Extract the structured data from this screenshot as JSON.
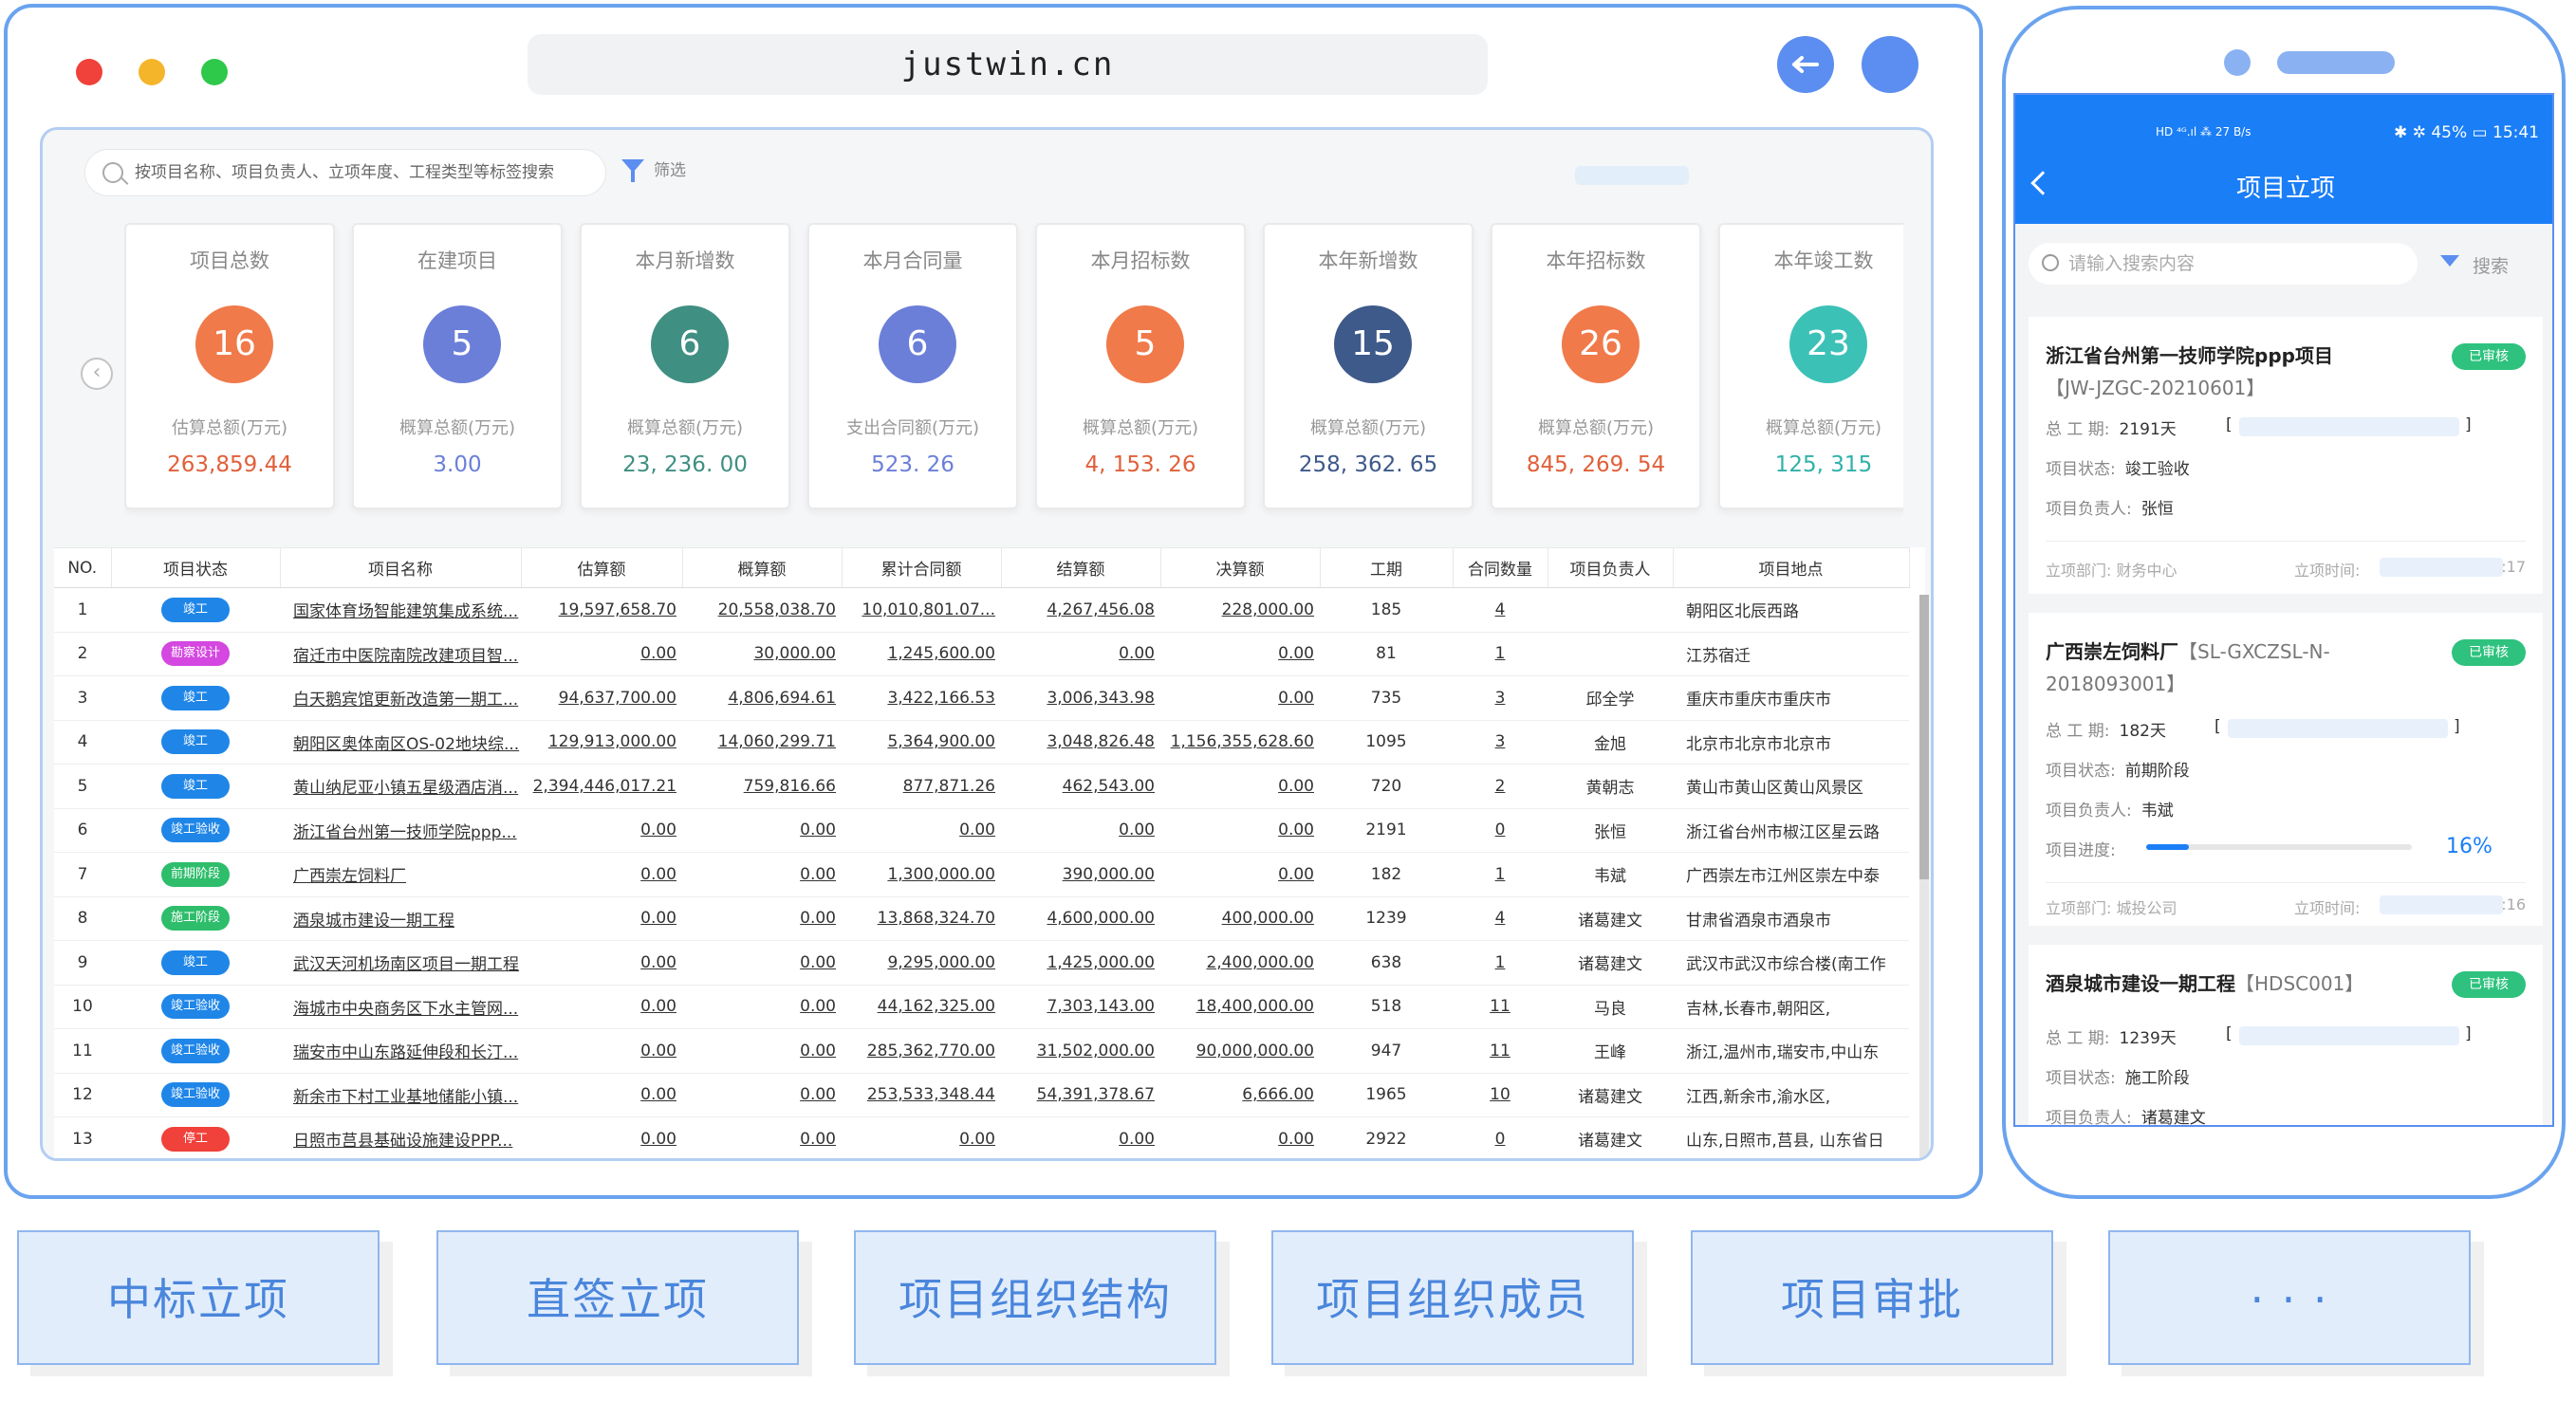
{
  "browser": {
    "url": "justwin.cn",
    "traffic_colors": [
      "#f0413a",
      "#f5b52b",
      "#2ec94a"
    ]
  },
  "toolbar": {
    "search_placeholder": "按项目名称、项目负责人、立项年度、工程类型等标签搜索",
    "filter_label": "筛选"
  },
  "cards": [
    {
      "label": "项目总数",
      "count": "16",
      "color": "#f07a4a",
      "sub": "估算总额(万元)",
      "value": "263,859.44",
      "value_color": "#e0603a"
    },
    {
      "label": "在建项目",
      "count": "5",
      "color": "#6b7fd9",
      "sub": "概算总额(万元)",
      "value": "3.00",
      "value_color": "#6b7fd9"
    },
    {
      "label": "本月新增数",
      "count": "6",
      "color": "#3f8f82",
      "sub": "概算总额(万元)",
      "value": "23, 236. 00",
      "value_color": "#3f8f82"
    },
    {
      "label": "本月合同量",
      "count": "6",
      "color": "#6b7fd9",
      "sub": "支出合同额(万元)",
      "value": "523. 26",
      "value_color": "#6b7fd9"
    },
    {
      "label": "本月招标数",
      "count": "5",
      "color": "#f07a4a",
      "sub": "概算总额(万元)",
      "value": "4, 153. 26",
      "value_color": "#e0603a"
    },
    {
      "label": "本年新增数",
      "count": "15",
      "color": "#3e5a8a",
      "sub": "概算总额(万元)",
      "value": "258, 362. 65",
      "value_color": "#3e5a8a"
    },
    {
      "label": "本年招标数",
      "count": "26",
      "color": "#f07a4a",
      "sub": "概算总额(万元)",
      "value": "845, 269. 54",
      "value_color": "#e0603a"
    },
    {
      "label": "本年竣工数",
      "count": "23",
      "color": "#3cc1b7",
      "sub": "概算总额(万元)",
      "value": "125, 315",
      "value_color": "#2fb1a8"
    }
  ],
  "table": {
    "headers": [
      "NO.",
      "项目状态",
      "项目名称",
      "估算额",
      "概算额",
      "累计合同额",
      "结算额",
      "决算额",
      "工期",
      "合同数量",
      "项目负责人",
      "项目地点"
    ],
    "rows": [
      {
        "no": "1",
        "status": "竣工",
        "status_color": "#1f86e8",
        "name": "国家体育场智能建筑集成系统...",
        "est": "19,597,658.70",
        "budget": "20,558,038.70",
        "contract": "10,010,801.07...",
        "settle": "4,267,456.08",
        "final": "228,000.00",
        "period": "185",
        "count": "4",
        "owner": "",
        "addr": "朝阳区北辰西路"
      },
      {
        "no": "2",
        "status": "勘察设计",
        "status_color": "#d447e0",
        "name": "宿迁市中医院南院改建项目智...",
        "est": "0.00",
        "budget": "30,000.00",
        "contract": "1,245,600.00",
        "settle": "0.00",
        "final": "0.00",
        "period": "81",
        "count": "1",
        "owner": "",
        "addr": "江苏宿迁"
      },
      {
        "no": "3",
        "status": "竣工",
        "status_color": "#1f86e8",
        "name": "白天鹅宾馆更新改造第一期工...",
        "est": "94,637,700.00",
        "budget": "4,806,694.61",
        "contract": "3,422,166.53",
        "settle": "3,006,343.98",
        "final": "0.00",
        "period": "735",
        "count": "3",
        "owner": "邱全学",
        "addr": "重庆市重庆市重庆市"
      },
      {
        "no": "4",
        "status": "竣工",
        "status_color": "#1f86e8",
        "name": "朝阳区奥体南区OS-02地块综...",
        "est": "129,913,000.00",
        "budget": "14,060,299.71",
        "contract": "5,364,900.00",
        "settle": "3,048,826.48",
        "final": "1,156,355,628.60",
        "period": "1095",
        "count": "3",
        "owner": "金旭",
        "addr": "北京市北京市北京市"
      },
      {
        "no": "5",
        "status": "竣工",
        "status_color": "#1f86e8",
        "name": "黄山纳尼亚小镇五星级酒店消...",
        "est": "2,394,446,017.21",
        "budget": "759,816.66",
        "contract": "877,871.26",
        "settle": "462,543.00",
        "final": "0.00",
        "period": "720",
        "count": "2",
        "owner": "黄朝志",
        "addr": "黄山市黄山区黄山风景区"
      },
      {
        "no": "6",
        "status": "竣工验收",
        "status_color": "#1f86e8",
        "name": "浙江省台州第一技师学院ppp...",
        "est": "0.00",
        "budget": "0.00",
        "contract": "0.00",
        "settle": "0.00",
        "final": "0.00",
        "period": "2191",
        "count": "0",
        "owner": "张恒",
        "addr": "浙江省台州市椒江区星云路"
      },
      {
        "no": "7",
        "status": "前期阶段",
        "status_color": "#2ebd6b",
        "name": "广西崇左饲料厂",
        "est": "0.00",
        "budget": "0.00",
        "contract": "1,300,000.00",
        "settle": "390,000.00",
        "final": "0.00",
        "period": "182",
        "count": "1",
        "owner": "韦斌",
        "addr": "广西崇左市江州区崇左中泰"
      },
      {
        "no": "8",
        "status": "施工阶段",
        "status_color": "#2ebd6b",
        "name": "酒泉城市建设一期工程",
        "est": "0.00",
        "budget": "0.00",
        "contract": "13,868,324.70",
        "settle": "4,600,000.00",
        "final": "400,000.00",
        "period": "1239",
        "count": "4",
        "owner": "诸葛建文",
        "addr": "甘肃省酒泉市酒泉市"
      },
      {
        "no": "9",
        "status": "竣工",
        "status_color": "#1f86e8",
        "name": "武汉天河机场南区项目一期工程",
        "est": "0.00",
        "budget": "0.00",
        "contract": "9,295,000.00",
        "settle": "1,425,000.00",
        "final": "2,400,000.00",
        "period": "638",
        "count": "1",
        "owner": "诸葛建文",
        "addr": "武汉市武汉市综合楼(南工作"
      },
      {
        "no": "10",
        "status": "竣工验收",
        "status_color": "#1f86e8",
        "name": "海城市中央商务区下水主管网...",
        "est": "0.00",
        "budget": "0.00",
        "contract": "44,162,325.00",
        "settle": "7,303,143.00",
        "final": "18,400,000.00",
        "period": "518",
        "count": "11",
        "owner": "马良",
        "addr": "吉林,长春市,朝阳区,"
      },
      {
        "no": "11",
        "status": "竣工验收",
        "status_color": "#1f86e8",
        "name": "瑞安市中山东路延伸段和长汀...",
        "est": "0.00",
        "budget": "0.00",
        "contract": "285,362,770.00",
        "settle": "31,502,000.00",
        "final": "90,000,000.00",
        "period": "947",
        "count": "11",
        "owner": "王峰",
        "addr": "浙江,温州市,瑞安市,中山东"
      },
      {
        "no": "12",
        "status": "竣工验收",
        "status_color": "#1f86e8",
        "name": "新余市下村工业基地储能小镇...",
        "est": "0.00",
        "budget": "0.00",
        "contract": "253,533,348.44",
        "settle": "54,391,378.67",
        "final": "6,666.00",
        "period": "1965",
        "count": "10",
        "owner": "诸葛建文",
        "addr": "江西,新余市,渝水区,"
      },
      {
        "no": "13",
        "status": "停工",
        "status_color": "#f0413a",
        "name": "日照市莒县基础设施建设PPP...",
        "est": "0.00",
        "budget": "0.00",
        "contract": "0.00",
        "settle": "0.00",
        "final": "0.00",
        "period": "2922",
        "count": "0",
        "owner": "诸葛建文",
        "addr": "山东,日照市,莒县, 山东省日"
      }
    ]
  },
  "phone": {
    "status_left": "HD ⁴ᴳ.ıl  ⁂  27 B/s",
    "status_right": "✱ ✲ 45% ▭ 15:41",
    "title": "项目立项",
    "search_placeholder": "请输入搜索内容",
    "filter_label": "搜索",
    "cards": [
      {
        "title": "浙江省台州第一技师学院ppp项目",
        "code": "【JW-JZGC-20210601】",
        "status": "已审核",
        "period_label": "总 工 期:",
        "period": "2191天",
        "state_label": "项目状态:",
        "state": "竣工验收",
        "owner_label": "项目负责人:",
        "owner": "张恒",
        "dept_label": "立项部门:",
        "dept": "财务中心",
        "time_label": "立项时间:",
        "time_tail": ":17"
      },
      {
        "title": "广西崇左饲料厂",
        "code": "【SL-GXCZSL-N-2018093001】",
        "status": "已审核",
        "period_label": "总 工 期:",
        "period": "182天",
        "state_label": "项目状态:",
        "state": "前期阶段",
        "owner_label": "项目负责人:",
        "owner": "韦斌",
        "progress_label": "项目进度:",
        "progress_text": "16%",
        "progress": 0.16,
        "dept_label": "立项部门:",
        "dept": "城投公司",
        "time_label": "立项时间:",
        "time_tail": ":16"
      },
      {
        "title": "酒泉城市建设一期工程",
        "code": "【HDSC001】",
        "status": "已审核",
        "period_label": "总 工 期:",
        "period": "1239天",
        "state_label": "项目状态:",
        "state": "施工阶段",
        "owner_label": "项目负责人:",
        "owner": "诸葛建文"
      }
    ]
  },
  "bottom_buttons": [
    "中标立项",
    "直签立项",
    "项目组织结构",
    "项目组织成员",
    "项目审批",
    "· · ·"
  ]
}
